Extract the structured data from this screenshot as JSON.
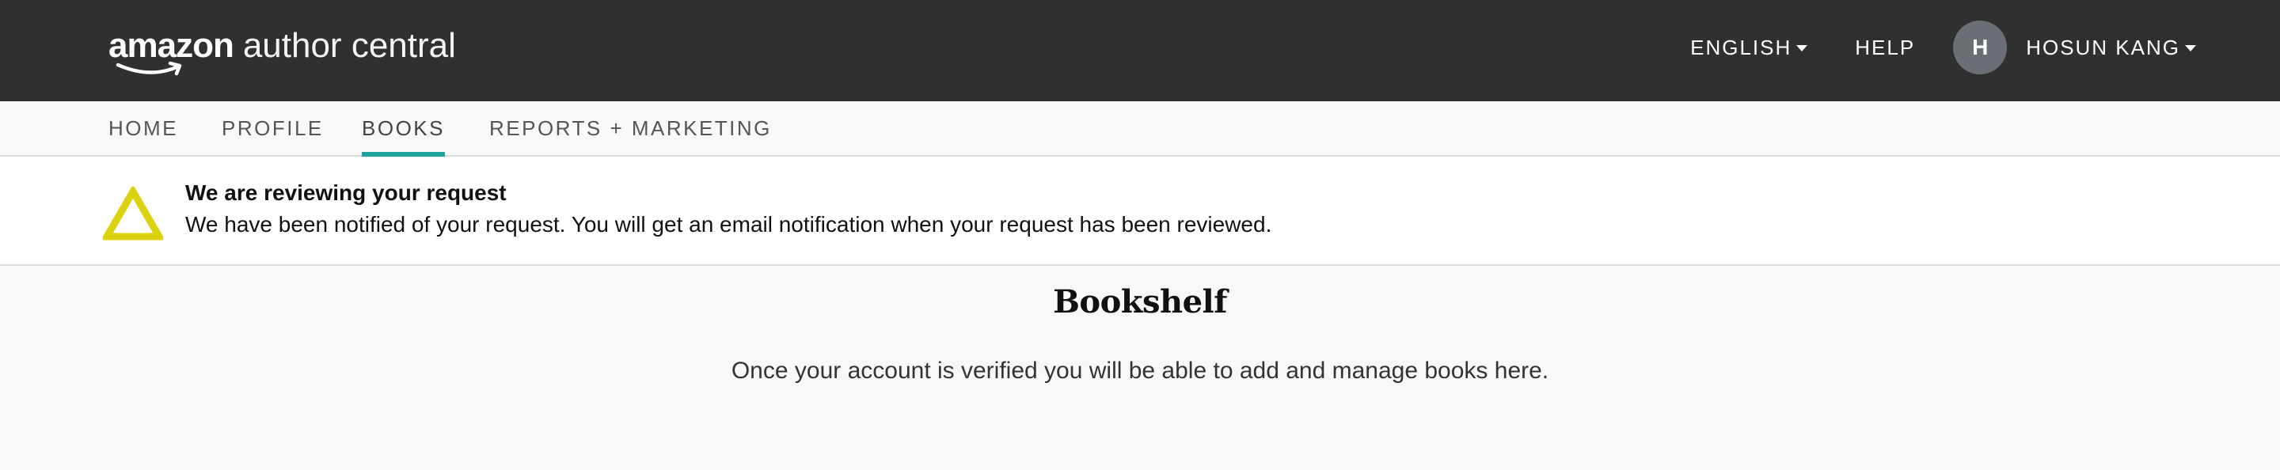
{
  "header": {
    "logo_brand": "amazon",
    "logo_product": "author central",
    "language_label": "ENGLISH",
    "help_label": "HELP",
    "avatar_initial": "H",
    "user_name": "HOSUN KANG",
    "background_color": "#303030"
  },
  "nav": {
    "items": [
      {
        "label": "HOME",
        "active": false
      },
      {
        "label": "PROFILE",
        "active": false
      },
      {
        "label": "BOOKS",
        "active": true
      },
      {
        "label": "REPORTS + MARKETING",
        "active": false
      }
    ],
    "active_color": "#20a39e"
  },
  "alert": {
    "icon": "warning-triangle-icon",
    "icon_color": "#dcd20f",
    "title": "We are reviewing your request",
    "message": "We have been notified of your request. You will get an email notification when your request has been reviewed."
  },
  "bookshelf": {
    "title": "Bookshelf",
    "message": "Once your account is verified you will be able to add and manage books here."
  }
}
